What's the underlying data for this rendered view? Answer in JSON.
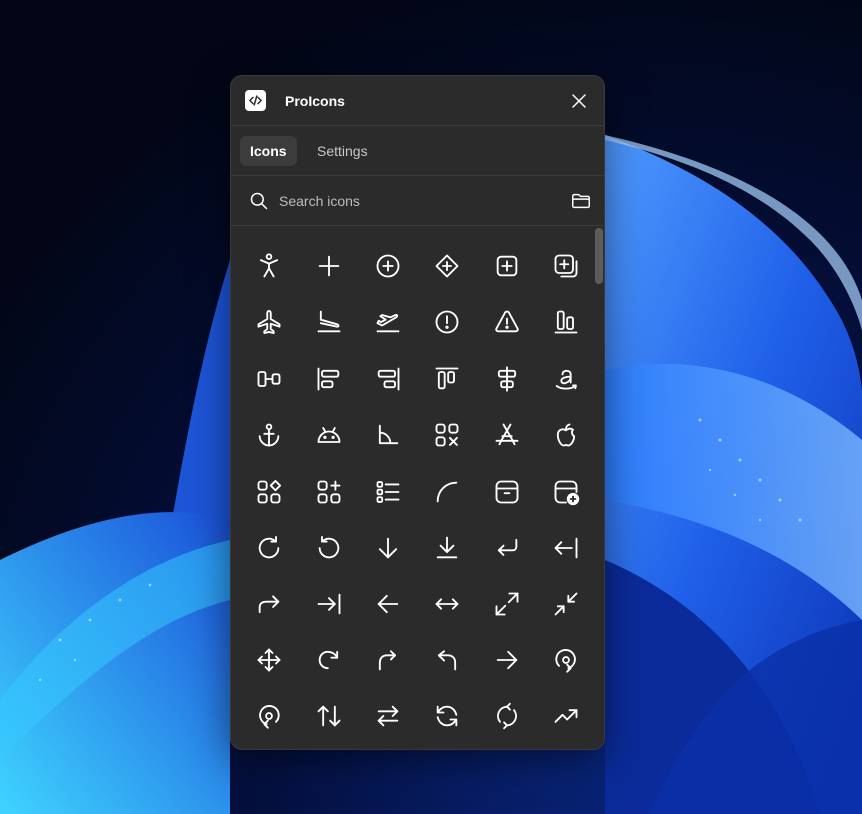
{
  "app": {
    "title": "ProIcons"
  },
  "tabs": [
    {
      "label": "Icons",
      "active": true
    },
    {
      "label": "Settings",
      "active": false
    }
  ],
  "search": {
    "placeholder": "Search icons",
    "value": ""
  },
  "colors": {
    "panel": "#2b2b2b",
    "accent_tab": "#3c3c3c",
    "icon_stroke": "#ffffff"
  },
  "icons": [
    [
      "accessibility-icon",
      "add-icon",
      "add-circle-icon",
      "add-diamond-icon",
      "add-square-icon",
      "add-square-multiple-icon"
    ],
    [
      "airplane-icon",
      "airplane-landing-icon",
      "airplane-takeoff-icon",
      "alert-circle-icon",
      "alert-triangle-icon",
      "align-bottom-icon"
    ],
    [
      "align-center-horizontal-icon",
      "align-left-icon",
      "align-right-icon",
      "align-top-icon",
      "align-center-vertical-icon",
      "amazon-icon"
    ],
    [
      "anchor-icon",
      "android-icon",
      "angle-icon",
      "app-grid-remove-icon",
      "app-store-icon",
      "apple-icon"
    ],
    [
      "apps-icon",
      "apps-add-icon",
      "apps-list-icon",
      "arc-icon",
      "archive-icon",
      "archive-add-icon"
    ],
    [
      "arrow-clockwise-icon",
      "arrow-counterclockwise-icon",
      "arrow-down-icon",
      "arrow-download-icon",
      "arrow-enter-icon",
      "arrow-export-left-icon"
    ],
    [
      "arrow-forward-icon",
      "arrow-import-icon",
      "arrow-left-icon",
      "arrow-left-right-icon",
      "arrow-maximize-icon",
      "arrow-minimize-icon"
    ],
    [
      "arrow-move-icon",
      "arrow-redo-icon",
      "arrow-reply-forward-icon",
      "arrow-reply-icon",
      "arrow-right-icon",
      "arrow-rotate-clockwise-icon"
    ],
    [
      "arrow-rotate-counterclockwise-icon",
      "arrow-sort-icon",
      "arrow-swap-icon",
      "arrow-sync-icon",
      "arrow-sync-circle-icon",
      "arrow-trending-icon"
    ]
  ]
}
